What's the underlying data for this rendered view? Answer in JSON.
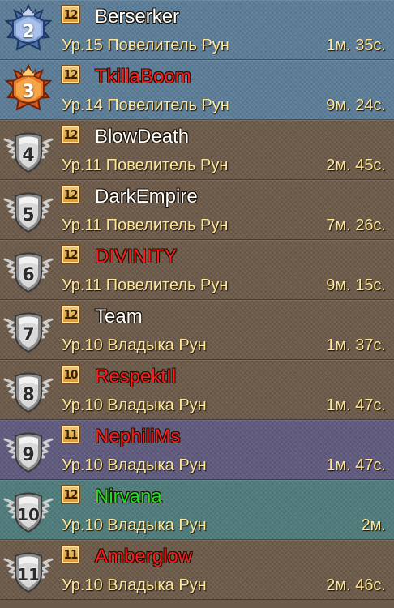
{
  "rows": [
    {
      "rank": "2",
      "level": "12",
      "name": "Berserker",
      "name_color": "#ffffff",
      "title": "Ур.15 Повелитель Рун",
      "time": "1м. 35с.",
      "bg": "#5b7d98",
      "badge": "blue-star"
    },
    {
      "rank": "3",
      "level": "12",
      "name": "TkillaBoom",
      "name_color": "#ff1a1a",
      "title": "Ур.14 Повелитель Рун",
      "time": "9м. 24с.",
      "bg": "#5b7d98",
      "badge": "orange-star"
    },
    {
      "rank": "4",
      "level": "12",
      "name": "BlowDeath",
      "name_color": "#ffffff",
      "title": "Ур.11 Повелитель Рун",
      "time": "2м. 45с.",
      "bg": "#6c5a48",
      "badge": "silver-winged"
    },
    {
      "rank": "5",
      "level": "12",
      "name": "DarkEmpire",
      "name_color": "#ffffff",
      "title": "Ур.11 Повелитель Рун",
      "time": "7м. 26с.",
      "bg": "#6c5a48",
      "badge": "silver-winged"
    },
    {
      "rank": "6",
      "level": "12",
      "name": "DIVINITY",
      "name_color": "#ff1a1a",
      "title": "Ур.11 Повелитель Рун",
      "time": "9м. 15с.",
      "bg": "#6c5a48",
      "badge": "silver-winged"
    },
    {
      "rank": "7",
      "level": "12",
      "name": "Team",
      "name_color": "#ffffff",
      "title": "Ур.10 Владыка Рун",
      "time": "1м. 37с.",
      "bg": "#6c5a48",
      "badge": "silver-winged"
    },
    {
      "rank": "8",
      "level": "10",
      "name": "RespektIl",
      "name_color": "#ff1a1a",
      "title": "Ур.10 Владыка Рун",
      "time": "1м. 47с.",
      "bg": "#6c5a48",
      "badge": "silver-winged"
    },
    {
      "rank": "9",
      "level": "11",
      "name": "NephiliMs",
      "name_color": "#ff1a1a",
      "title": "Ур.10 Владыка Рун",
      "time": "1м. 47с.",
      "bg": "#5f5a7e",
      "badge": "silver-winged"
    },
    {
      "rank": "10",
      "level": "12",
      "name": "Nirvana",
      "name_color": "#22dd22",
      "title": "Ур.10 Владыка Рун",
      "time": "2м.",
      "bg": "#4e7c7c",
      "badge": "silver-winged"
    },
    {
      "rank": "11",
      "level": "11",
      "name": "Amberglow",
      "name_color": "#ff1a1a",
      "title": "Ур.10 Владыка Рун",
      "time": "2м. 46с.",
      "bg": "#6c5a48",
      "badge": "silver-winged"
    }
  ]
}
